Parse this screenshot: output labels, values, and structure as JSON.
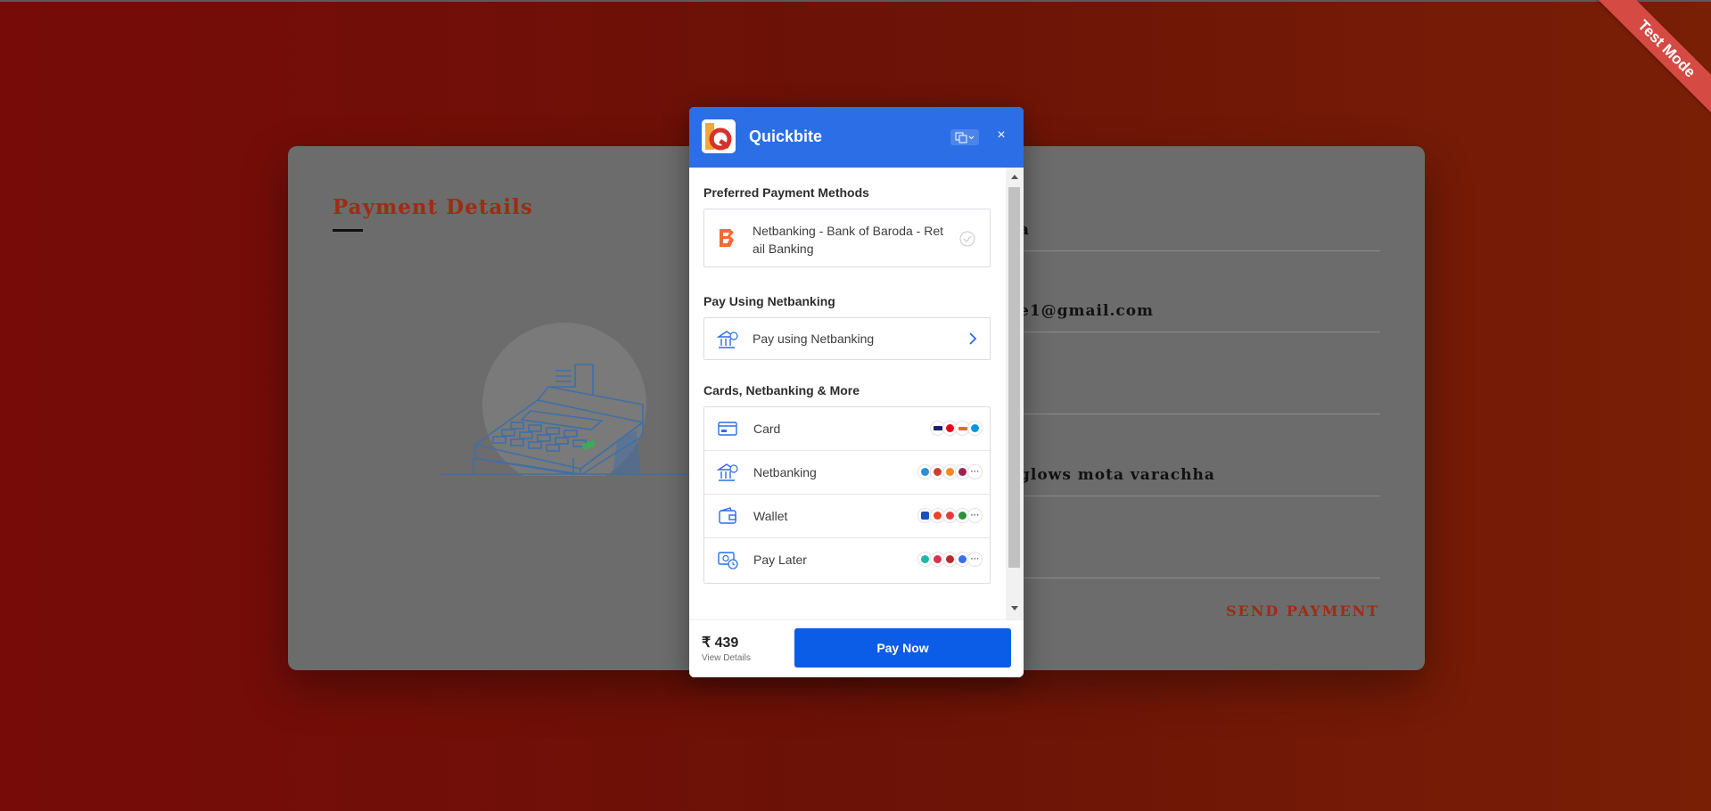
{
  "page": {
    "title": "Payment Details",
    "fields": [
      "a",
      "e1@gmail.com",
      "",
      "glows mota varachha",
      ""
    ],
    "send_button": "SEND PAYMENT",
    "ribbon": "Test Mode"
  },
  "checkout": {
    "merchant_name": "Quickbite",
    "language_icon": "translate-icon",
    "close_label": "×",
    "preferred": {
      "title": "Preferred Payment Methods",
      "item_label": "Netbanking - Bank of Baroda - Retail Banking",
      "item_line1": "Netbanking - Bank of Baroda - Ret",
      "item_line2": "ail Banking"
    },
    "netbanking_section": {
      "title": "Pay Using Netbanking",
      "label": "Pay using Netbanking"
    },
    "more_section": {
      "title": "Cards, Netbanking & More",
      "methods": [
        {
          "label": "Card",
          "icon": "card-icon"
        },
        {
          "label": "Netbanking",
          "icon": "bank-icon"
        },
        {
          "label": "Wallet",
          "icon": "wallet-icon"
        },
        {
          "label": "Pay Later",
          "icon": "pay-later-icon"
        }
      ]
    },
    "footer": {
      "amount": "₹ 439",
      "view_details": "View Details",
      "pay_button": "Pay Now"
    }
  },
  "colors": {
    "header_blue": "#2b6ee6",
    "pay_button": "#0b5ce6",
    "background_red": "#770b08",
    "accent": "#9e2c12",
    "ribbon": "#d64a44"
  }
}
